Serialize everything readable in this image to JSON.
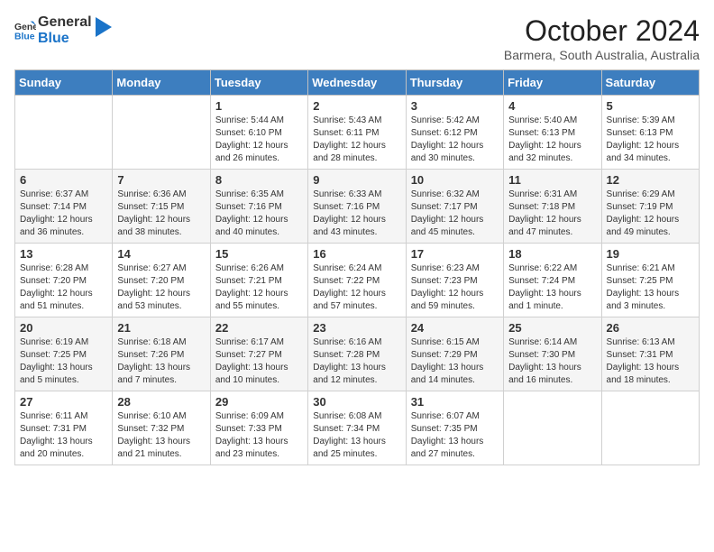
{
  "logo": {
    "line1": "General",
    "line2": "Blue"
  },
  "header": {
    "month": "October 2024",
    "location": "Barmera, South Australia, Australia"
  },
  "days_of_week": [
    "Sunday",
    "Monday",
    "Tuesday",
    "Wednesday",
    "Thursday",
    "Friday",
    "Saturday"
  ],
  "weeks": [
    [
      {
        "day": "",
        "info": ""
      },
      {
        "day": "",
        "info": ""
      },
      {
        "day": "1",
        "info": "Sunrise: 5:44 AM\nSunset: 6:10 PM\nDaylight: 12 hours\nand 26 minutes."
      },
      {
        "day": "2",
        "info": "Sunrise: 5:43 AM\nSunset: 6:11 PM\nDaylight: 12 hours\nand 28 minutes."
      },
      {
        "day": "3",
        "info": "Sunrise: 5:42 AM\nSunset: 6:12 PM\nDaylight: 12 hours\nand 30 minutes."
      },
      {
        "day": "4",
        "info": "Sunrise: 5:40 AM\nSunset: 6:13 PM\nDaylight: 12 hours\nand 32 minutes."
      },
      {
        "day": "5",
        "info": "Sunrise: 5:39 AM\nSunset: 6:13 PM\nDaylight: 12 hours\nand 34 minutes."
      }
    ],
    [
      {
        "day": "6",
        "info": "Sunrise: 6:37 AM\nSunset: 7:14 PM\nDaylight: 12 hours\nand 36 minutes."
      },
      {
        "day": "7",
        "info": "Sunrise: 6:36 AM\nSunset: 7:15 PM\nDaylight: 12 hours\nand 38 minutes."
      },
      {
        "day": "8",
        "info": "Sunrise: 6:35 AM\nSunset: 7:16 PM\nDaylight: 12 hours\nand 40 minutes."
      },
      {
        "day": "9",
        "info": "Sunrise: 6:33 AM\nSunset: 7:16 PM\nDaylight: 12 hours\nand 43 minutes."
      },
      {
        "day": "10",
        "info": "Sunrise: 6:32 AM\nSunset: 7:17 PM\nDaylight: 12 hours\nand 45 minutes."
      },
      {
        "day": "11",
        "info": "Sunrise: 6:31 AM\nSunset: 7:18 PM\nDaylight: 12 hours\nand 47 minutes."
      },
      {
        "day": "12",
        "info": "Sunrise: 6:29 AM\nSunset: 7:19 PM\nDaylight: 12 hours\nand 49 minutes."
      }
    ],
    [
      {
        "day": "13",
        "info": "Sunrise: 6:28 AM\nSunset: 7:20 PM\nDaylight: 12 hours\nand 51 minutes."
      },
      {
        "day": "14",
        "info": "Sunrise: 6:27 AM\nSunset: 7:20 PM\nDaylight: 12 hours\nand 53 minutes."
      },
      {
        "day": "15",
        "info": "Sunrise: 6:26 AM\nSunset: 7:21 PM\nDaylight: 12 hours\nand 55 minutes."
      },
      {
        "day": "16",
        "info": "Sunrise: 6:24 AM\nSunset: 7:22 PM\nDaylight: 12 hours\nand 57 minutes."
      },
      {
        "day": "17",
        "info": "Sunrise: 6:23 AM\nSunset: 7:23 PM\nDaylight: 12 hours\nand 59 minutes."
      },
      {
        "day": "18",
        "info": "Sunrise: 6:22 AM\nSunset: 7:24 PM\nDaylight: 13 hours\nand 1 minute."
      },
      {
        "day": "19",
        "info": "Sunrise: 6:21 AM\nSunset: 7:25 PM\nDaylight: 13 hours\nand 3 minutes."
      }
    ],
    [
      {
        "day": "20",
        "info": "Sunrise: 6:19 AM\nSunset: 7:25 PM\nDaylight: 13 hours\nand 5 minutes."
      },
      {
        "day": "21",
        "info": "Sunrise: 6:18 AM\nSunset: 7:26 PM\nDaylight: 13 hours\nand 7 minutes."
      },
      {
        "day": "22",
        "info": "Sunrise: 6:17 AM\nSunset: 7:27 PM\nDaylight: 13 hours\nand 10 minutes."
      },
      {
        "day": "23",
        "info": "Sunrise: 6:16 AM\nSunset: 7:28 PM\nDaylight: 13 hours\nand 12 minutes."
      },
      {
        "day": "24",
        "info": "Sunrise: 6:15 AM\nSunset: 7:29 PM\nDaylight: 13 hours\nand 14 minutes."
      },
      {
        "day": "25",
        "info": "Sunrise: 6:14 AM\nSunset: 7:30 PM\nDaylight: 13 hours\nand 16 minutes."
      },
      {
        "day": "26",
        "info": "Sunrise: 6:13 AM\nSunset: 7:31 PM\nDaylight: 13 hours\nand 18 minutes."
      }
    ],
    [
      {
        "day": "27",
        "info": "Sunrise: 6:11 AM\nSunset: 7:31 PM\nDaylight: 13 hours\nand 20 minutes."
      },
      {
        "day": "28",
        "info": "Sunrise: 6:10 AM\nSunset: 7:32 PM\nDaylight: 13 hours\nand 21 minutes."
      },
      {
        "day": "29",
        "info": "Sunrise: 6:09 AM\nSunset: 7:33 PM\nDaylight: 13 hours\nand 23 minutes."
      },
      {
        "day": "30",
        "info": "Sunrise: 6:08 AM\nSunset: 7:34 PM\nDaylight: 13 hours\nand 25 minutes."
      },
      {
        "day": "31",
        "info": "Sunrise: 6:07 AM\nSunset: 7:35 PM\nDaylight: 13 hours\nand 27 minutes."
      },
      {
        "day": "",
        "info": ""
      },
      {
        "day": "",
        "info": ""
      }
    ]
  ]
}
